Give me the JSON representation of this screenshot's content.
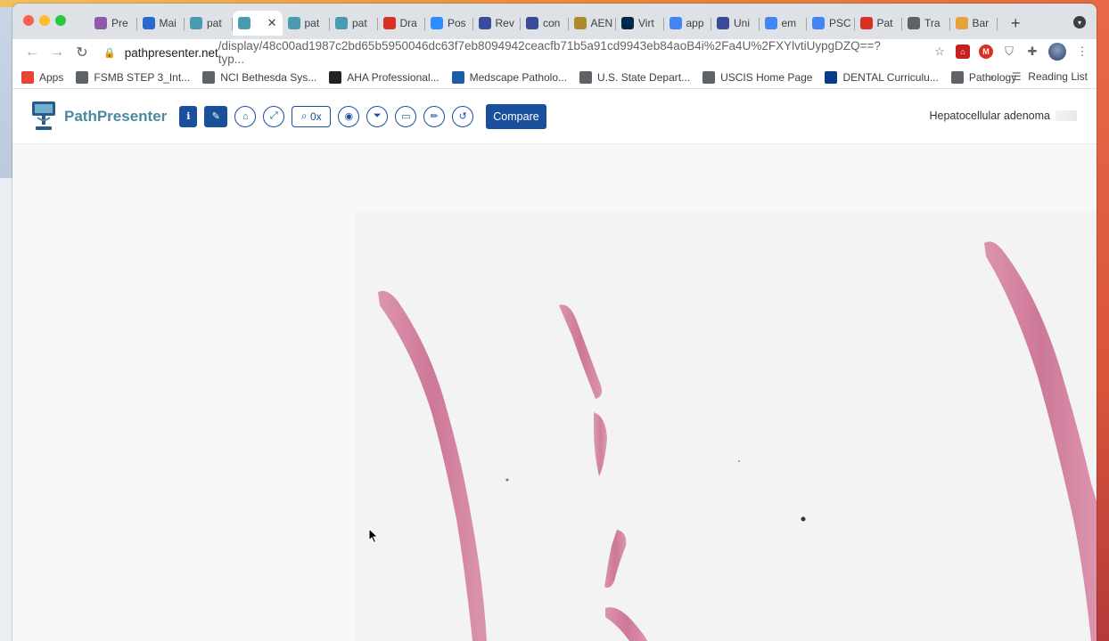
{
  "browser": {
    "tabs": [
      {
        "label": "Pre",
        "color": "#8e5aa8"
      },
      {
        "label": "Mai",
        "color": "#2a6ad0"
      },
      {
        "label": "pat",
        "color": "#4a9ab0"
      },
      {
        "label": "",
        "color": "#4a9ab0",
        "active": true
      },
      {
        "label": "pat",
        "color": "#4a9ab0"
      },
      {
        "label": "pat",
        "color": "#4a9ab0"
      },
      {
        "label": "Dra",
        "color": "#d93025"
      },
      {
        "label": "Pos",
        "color": "#2d8cff"
      },
      {
        "label": "Rev",
        "color": "#3a4a9a"
      },
      {
        "label": "con",
        "color": "#3a4a9a"
      },
      {
        "label": "AEN",
        "color": "#b08a2a"
      },
      {
        "label": "Virt",
        "color": "#00274c"
      },
      {
        "label": "app",
        "color": "#4285f4"
      },
      {
        "label": "Uni",
        "color": "#3a4a9a"
      },
      {
        "label": "em",
        "color": "#4285f4"
      },
      {
        "label": "PSC",
        "color": "#4285f4"
      },
      {
        "label": "Pat",
        "color": "#d93025"
      },
      {
        "label": "Tra",
        "color": "#5f6368"
      },
      {
        "label": "Bar",
        "color": "#e8a23a"
      }
    ],
    "url_host": "pathpresenter.net",
    "url_rest": "/display/48c00ad1987c2bd65b5950046dc63f7eb8094942ceacfb71b5a91cd9943eb84aoB4i%2Fa4U%2FXYlvtiUypgDZQ==?typ...",
    "bookmarks": [
      {
        "label": "Apps",
        "color": "#ea4335"
      },
      {
        "label": "FSMB STEP 3_Int...",
        "color": "#5f6368"
      },
      {
        "label": "NCI Bethesda Sys...",
        "color": "#5f6368"
      },
      {
        "label": "AHA Professional...",
        "color": "#222222"
      },
      {
        "label": "Medscape Patholo...",
        "color": "#1a5ca8"
      },
      {
        "label": "U.S. State Depart...",
        "color": "#5f6368"
      },
      {
        "label": "USCIS Home Page",
        "color": "#5f6368"
      },
      {
        "label": "DENTAL Curriculu...",
        "color": "#0a3a8a"
      },
      {
        "label": "Pathology",
        "color": "#5f6368"
      }
    ],
    "more_label": "»",
    "reading_list": "Reading List"
  },
  "app": {
    "logo_text": "PathPresenter",
    "zoom_label": "0x",
    "compare_label": "Compare",
    "case_title": "Hepatocellular adenoma",
    "accent": "#1a4f9c"
  }
}
